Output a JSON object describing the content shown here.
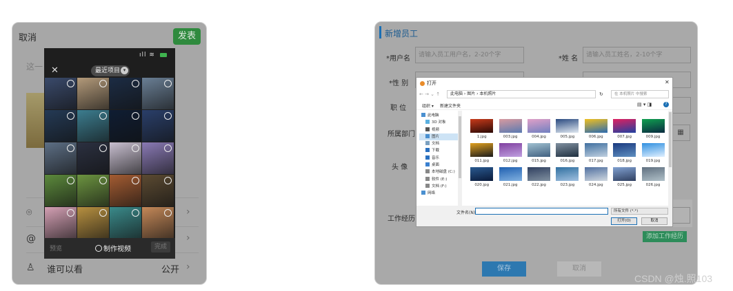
{
  "phone": {
    "cancel": "取消",
    "publish": "发表",
    "hint": "这一",
    "rows": [
      {
        "icon": "location-icon",
        "label": "",
        "value": ""
      },
      {
        "icon": "at-icon",
        "label": "",
        "value": ""
      },
      {
        "icon": "person-icon",
        "label": "谁可以看",
        "value": "公开"
      }
    ],
    "picker": {
      "close": "✕",
      "album": "最近项目",
      "preview": "预览",
      "make_video": "制作视频",
      "done": "完成",
      "cells": [
        "#3a4a6b",
        "#b39a7a",
        "#1c2c44",
        "#6a7f95",
        "#243a55",
        "#3c7d8f",
        "#0f1d33",
        "#2a3f6a",
        "#5d6f85",
        "#2b3040",
        "#c8bfd0",
        "#8a7ab5",
        "#5c8a3c",
        "#6c9440",
        "#a45c32",
        "#5b4a32",
        "#d4a0b4",
        "#b79040",
        "#3a8a8a",
        "#c48858"
      ]
    }
  },
  "form": {
    "title": "新增员工",
    "username_label": "*用户名",
    "username_ph": "请输入员工用户名，2-20个字",
    "name_label": "*姓  名",
    "name_ph": "请输入员工姓名，2-10个字",
    "gender_label": "*性  别",
    "position_label": "职  位",
    "dept_label": "所属部门",
    "avatar_label": "头  像",
    "work_label": "工作经历",
    "add_work": "添加工作经历",
    "save": "保存",
    "cancel": "取消"
  },
  "dialog": {
    "title": "打开",
    "path": "此电脑 › 图片 › 本机照片",
    "search_ph": "在 本机照片 中搜索",
    "organize": "组织 ▾",
    "new_folder": "新建文件夹",
    "tree": [
      {
        "label": "此电脑",
        "color": "#4a90d0"
      },
      {
        "label": "3D 对象",
        "color": "#5ab0e0"
      },
      {
        "label": "视频",
        "color": "#555"
      },
      {
        "label": "图片",
        "color": "#4a90d0"
      },
      {
        "label": "文档",
        "color": "#7aa0c0"
      },
      {
        "label": "下载",
        "color": "#2a70c0"
      },
      {
        "label": "音乐",
        "color": "#2a70c0"
      },
      {
        "label": "桌面",
        "color": "#3a80d0"
      },
      {
        "label": "本地磁盘 (C:)",
        "color": "#888"
      },
      {
        "label": "软件 (E:)",
        "color": "#888"
      },
      {
        "label": "文档 (F:)",
        "color": "#888"
      },
      {
        "label": "网络",
        "color": "#4a90d0"
      }
    ],
    "files": [
      {
        "name": "1.jpg",
        "c1": "#c83a1a",
        "c2": "#2a0a06"
      },
      {
        "name": "003.jpg",
        "c1": "#d89aa0",
        "c2": "#5a7ab0"
      },
      {
        "name": "004.jpg",
        "c1": "#e0a0c8",
        "c2": "#7080c0"
      },
      {
        "name": "005.jpg",
        "c1": "#2a4a80",
        "c2": "#e0e8f0"
      },
      {
        "name": "006.jpg",
        "c1": "#f0c020",
        "c2": "#2a6ab0"
      },
      {
        "name": "007.jpg",
        "c1": "#e02060",
        "c2": "#2040a0"
      },
      {
        "name": "009.jpg",
        "c1": "#10a050",
        "c2": "#0a2a40"
      },
      {
        "name": "011.jpg",
        "c1": "#e0a020",
        "c2": "#1a1a1a"
      },
      {
        "name": "012.jpg",
        "c1": "#8040a0",
        "c2": "#c0a0e0"
      },
      {
        "name": "015.jpg",
        "c1": "#a0c0d0",
        "c2": "#406080"
      },
      {
        "name": "016.jpg",
        "c1": "#8090a0",
        "c2": "#203040"
      },
      {
        "name": "017.jpg",
        "c1": "#4070a0",
        "c2": "#c0d0e0"
      },
      {
        "name": "018.jpg",
        "c1": "#1a3a80",
        "c2": "#6090c0"
      },
      {
        "name": "019.jpg",
        "c1": "#3090e0",
        "c2": "#e0f0ff"
      },
      {
        "name": "020.jpg",
        "c1": "#2a5a90",
        "c2": "#0a1a3a"
      },
      {
        "name": "021.jpg",
        "c1": "#2060b0",
        "c2": "#80b0e0"
      },
      {
        "name": "022.jpg",
        "c1": "#304060",
        "c2": "#8090a0"
      },
      {
        "name": "023.jpg",
        "c1": "#3070a0",
        "c2": "#a0c0e0"
      },
      {
        "name": "024.jpg",
        "c1": "#5070a0",
        "c2": "#d0d8e0"
      },
      {
        "name": "025.jpg",
        "c1": "#80a0d0",
        "c2": "#304060"
      },
      {
        "name": "026.jpg",
        "c1": "#607080",
        "c2": "#b0c0c8"
      }
    ],
    "filename_label": "文件名(N):",
    "filetype": "所有文件 (*.*)",
    "open": "打开(O)",
    "cancel": "取消"
  },
  "watermark": "CSDN @烛.照103"
}
